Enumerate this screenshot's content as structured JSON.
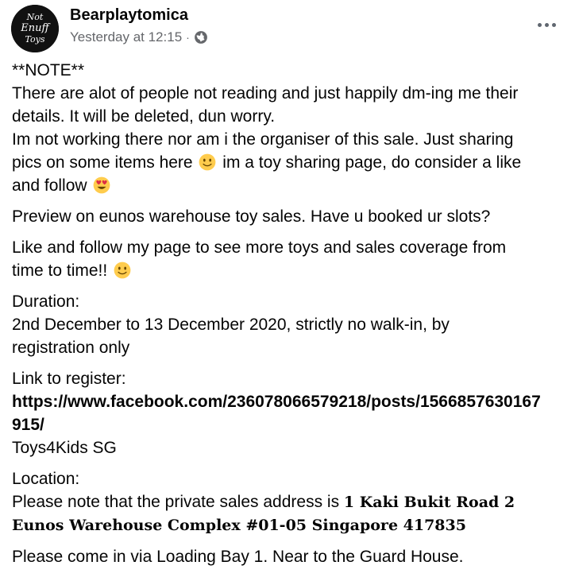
{
  "post": {
    "author": "Bearplaytomica",
    "timestamp": "Yesterday at 12:15",
    "separator": "·",
    "privacy_icon": "globe-icon",
    "more_icon": "more-horizontal-icon",
    "avatar": {
      "line1": "Not",
      "line2": "Enuff",
      "line3": "Toys"
    }
  },
  "content": {
    "note_header": "**NOTE**",
    "note_line1": "There are alot of people not reading and just happily dm-ing me their",
    "note_line2": "details. It will be deleted, dun worry.",
    "note_line3": "Im not working there nor am i the organiser of this sale. Just sharing",
    "note_line4a": "pics on some items here",
    "note_line4b": "im a toy sharing page, do consider a like",
    "note_line5": "and follow",
    "preview": "Preview on eunos warehouse toy sales. Have u booked ur slots?",
    "follow_line1": "Like and follow my page to see more toys and sales coverage from",
    "follow_line2": "time to time!!",
    "duration_label": "Duration:",
    "duration_line1": "2nd December to 13 December 2020, strictly no walk-in, by",
    "duration_line2": "registration only",
    "register_label": "Link to register:",
    "register_link_line1": "https://www.facebook.com/236078066579218/posts/1566857630167",
    "register_link_line2": "915/",
    "register_org": "Toys4Kids SG",
    "location_label": "Location:",
    "location_intro": "Please note that the private sales address is",
    "location_address1": "1 Kaki Bukit Road 2",
    "location_address2": "Eunos Warehouse Complex #01-05 Singapore 417835",
    "directions": "Please come in via Loading Bay 1. Near to the Guard House."
  },
  "emojis": {
    "smile": "slightly-smiling-face-emoji",
    "heart_eyes": "heart-eyes-emoji"
  },
  "colors": {
    "text": "#050505",
    "secondary": "#65676b",
    "emoji_yellow": "#ffcc4d",
    "heart_red": "#dd2e44"
  }
}
